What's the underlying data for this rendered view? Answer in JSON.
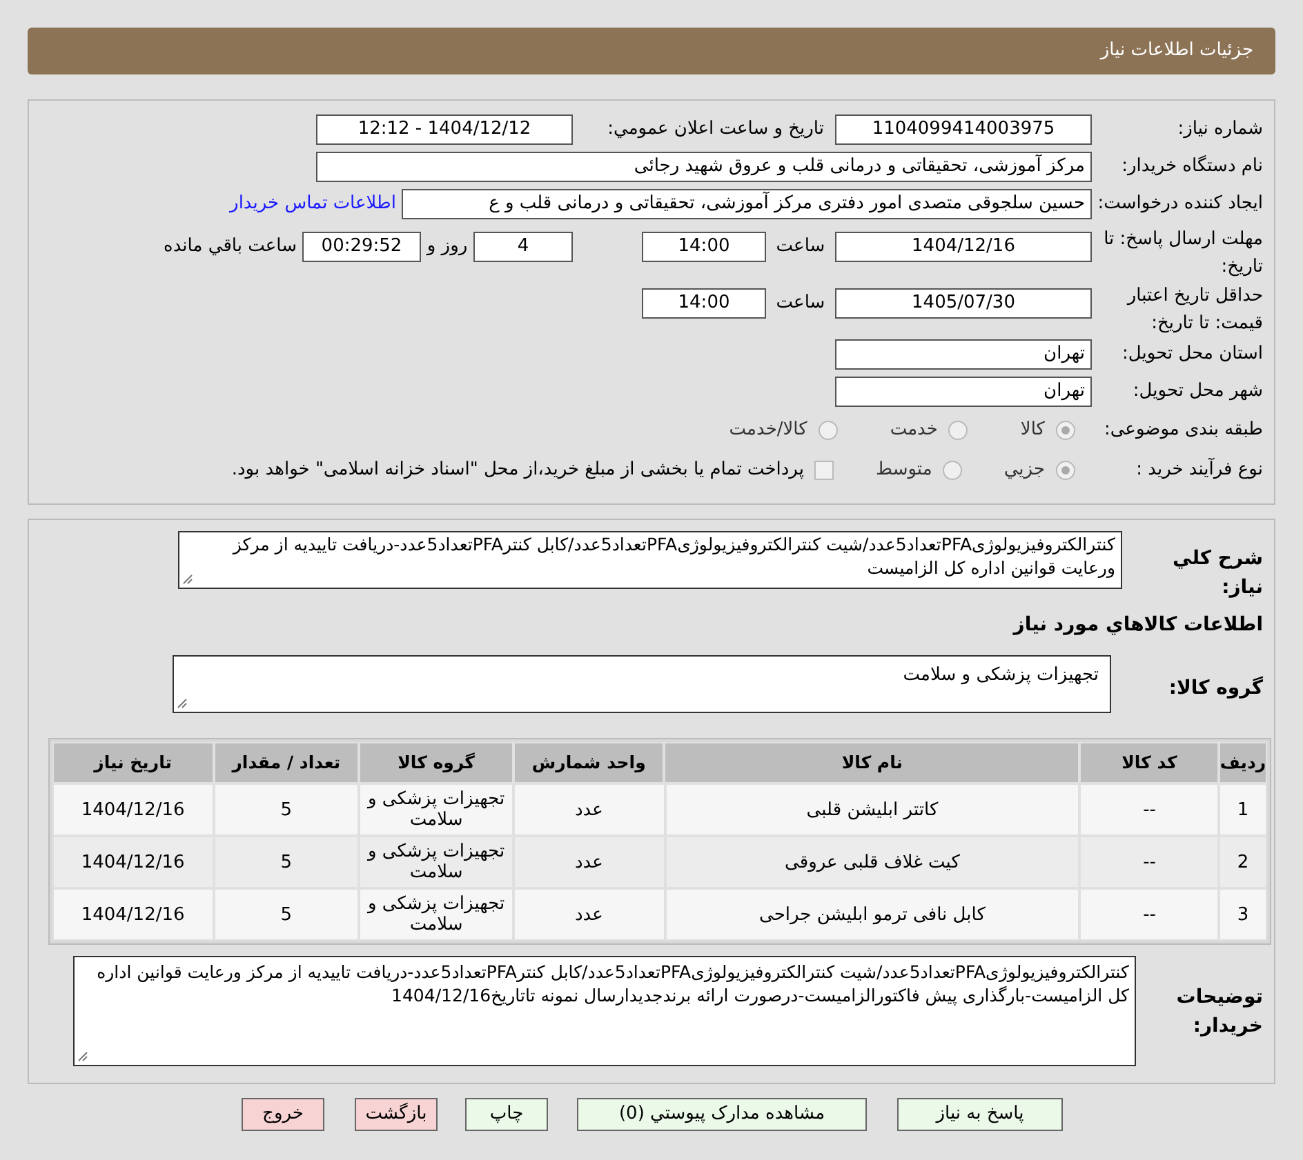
{
  "header": {
    "title": "جزئیات اطلاعات نیاز"
  },
  "need_number": {
    "label": "شماره نیاز:",
    "value": "1104099414003975"
  },
  "announce": {
    "label": "تاريخ و ساعت اعلان عمومي:",
    "value": "1404/12/12 - 12:12"
  },
  "buyer_org": {
    "label": "نام دستگاه خریدار:",
    "value": "مرکز آموزشی، تحقیقاتی و درمانی قلب و عروق شهید رجائی"
  },
  "requester": {
    "label": "ایجاد کننده درخواست:",
    "value": "حسین سلجوقی متصدی امور دفتری مرکز آموزشی، تحقیقاتی و درمانی قلب و ع",
    "link": "اطلاعات تماس خریدار"
  },
  "deadline": {
    "label": "مهلت ارسال پاسخ: تا تاریخ:",
    "date": "1404/12/16",
    "time_label": "ساعت",
    "time": "14:00",
    "days": "4",
    "days_suffix": "روز و",
    "remaining": "00:29:52",
    "remaining_suffix": "ساعت باقي مانده"
  },
  "validity": {
    "label": "حداقل تاریخ اعتبار قیمت: تا تاریخ:",
    "date": "1405/07/30",
    "time_label": "ساعت",
    "time": "14:00"
  },
  "province": {
    "label": "استان محل تحویل:",
    "value": "تهران"
  },
  "city": {
    "label": "شهر محل تحویل:",
    "value": "تهران"
  },
  "category": {
    "label": "طبقه بندی موضوعی:",
    "options": [
      {
        "label": "کالا",
        "selected": true
      },
      {
        "label": "خدمت",
        "selected": false
      },
      {
        "label": "کالا/خدمت",
        "selected": false
      }
    ]
  },
  "purchase_type": {
    "label": "نوع فرآیند خرید :",
    "options": [
      {
        "label": "جزيي",
        "selected": true
      },
      {
        "label": "متوسط",
        "selected": false
      }
    ],
    "checkbox": {
      "checked": false,
      "label": "پرداخت تمام یا بخشی از مبلغ خرید،از محل \"اسناد خزانه اسلامی\" خواهد بود."
    }
  },
  "summary": {
    "label": "شرح کلي نياز:",
    "value": "کنترالکتروفیزیولوژیPFAتعداد5عدد/شیت کنترالکتروفیزیولوژیPFAتعداد5عدد/کابل کنترPFAتعداد5عدد-دریافت تاییدیه از مرکز ورعایت قوانین اداره کل الزامیست"
  },
  "goods_heading": "اطلاعات کالاهاي مورد نياز",
  "goods_group": {
    "label": "گروه کالا:",
    "value": "تجهیزات پزشکی و سلامت"
  },
  "table": {
    "columns": [
      "ردیف",
      "کد کالا",
      "نام کالا",
      "واحد شمارش",
      "گروه کالا",
      "تعداد / مقدار",
      "تاریخ نیاز"
    ],
    "rows": [
      [
        "1",
        "--",
        "کاتتر ابلیشن قلبی",
        "عدد",
        "تجهیزات پزشکی و سلامت",
        "5",
        "1404/12/16"
      ],
      [
        "2",
        "--",
        "کیت غلاف قلبی عروقی",
        "عدد",
        "تجهیزات پزشکی و سلامت",
        "5",
        "1404/12/16"
      ],
      [
        "3",
        "--",
        "کابل نافی ترمو ابلیشن جراحی",
        "عدد",
        "تجهیزات پزشکی و سلامت",
        "5",
        "1404/12/16"
      ]
    ]
  },
  "buyer_notes": {
    "label": "توضیحات خریدار:",
    "value": "کنترالکتروفیزیولوژیPFAتعداد5عدد/شیت کنترالکتروفیزیولوژیPFAتعداد5عدد/کابل کنترPFAتعداد5عدد-دریافت تاییدیه از مرکز ورعایت قوانین اداره کل الزامیست-بارگذاری پیش فاکتورالزامیست-درصورت ارائه برندجدیدارسال نمونه تاتاریخ1404/12/16"
  },
  "buttons": [
    {
      "label": "پاسخ به نیاز",
      "kind": "green"
    },
    {
      "label": "مشاهده مدارک پیوستي (0)",
      "kind": "green"
    },
    {
      "label": "چاپ",
      "kind": "green"
    },
    {
      "label": "بازگشت",
      "kind": "red"
    },
    {
      "label": "خروج",
      "kind": "red"
    }
  ]
}
